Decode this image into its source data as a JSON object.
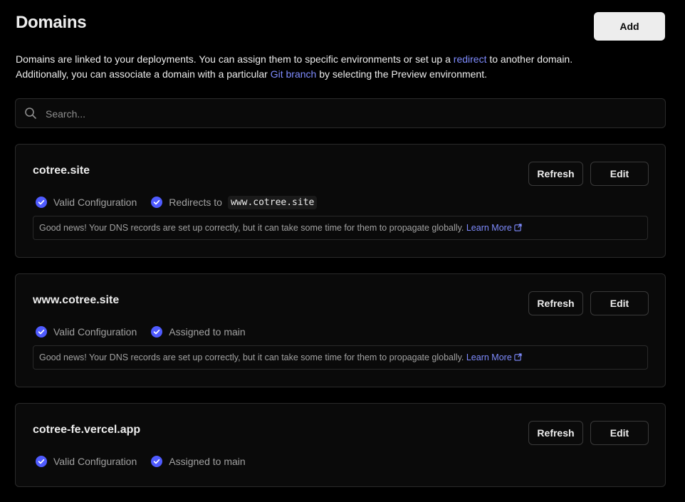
{
  "header": {
    "title": "Domains",
    "add_label": "Add"
  },
  "intro": {
    "line1_before": "Domains are linked to your deployments. You can assign them to specific environments or set up a ",
    "line1_link": "redirect",
    "line1_after": " to another domain.",
    "line2_before": "Additionally, you can associate a domain with a particular ",
    "line2_link": "Git branch",
    "line2_after": " by selecting the Preview environment."
  },
  "search": {
    "placeholder": "Search...",
    "value": ""
  },
  "domains": [
    {
      "name": "cotree.site",
      "refresh_label": "Refresh",
      "edit_label": "Edit",
      "status1": "Valid Configuration",
      "status2": "Redirects to",
      "redirect_target": "www.cotree.site",
      "notice": "Good news! Your DNS records are set up correctly, but it can take some time for them to propagate globally.",
      "learn_more": "Learn More"
    },
    {
      "name": "www.cotree.site",
      "refresh_label": "Refresh",
      "edit_label": "Edit",
      "status1": "Valid Configuration",
      "status2": "Assigned to main",
      "notice": "Good news! Your DNS records are set up correctly, but it can take some time for them to propagate globally.",
      "learn_more": "Learn More"
    },
    {
      "name": "cotree-fe.vercel.app",
      "refresh_label": "Refresh",
      "edit_label": "Edit",
      "status1": "Valid Configuration",
      "status2": "Assigned to main"
    }
  ],
  "colors": {
    "background": "#000000",
    "card": "#0a0a0a",
    "border": "#2a2a2a",
    "link": "#7f8cff",
    "check": "#4f5bff",
    "primary_button": "#ededed"
  },
  "icons": {
    "search": "search-icon",
    "check": "check-circle-icon",
    "external": "external-link-icon"
  }
}
